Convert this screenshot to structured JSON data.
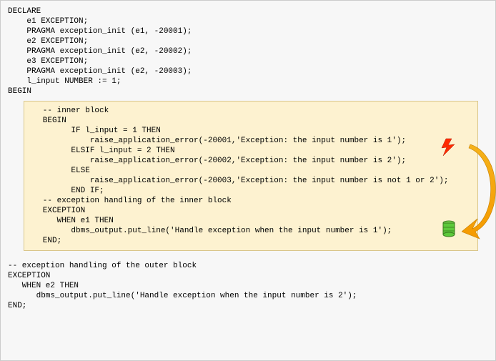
{
  "outer": {
    "l1": "DECLARE",
    "l2": "    e1 EXCEPTION;",
    "l3": "    PRAGMA exception_init (e1, -20001);",
    "l4": "    e2 EXCEPTION;",
    "l5": "    PRAGMA exception_init (e2, -20002);",
    "l6": "    e3 EXCEPTION;",
    "l7": "    PRAGMA exception_init (e2, -20003);",
    "l8": "    l_input NUMBER := 1;",
    "l9": "BEGIN"
  },
  "inner": {
    "l1": "   -- inner block",
    "l2": "   BEGIN",
    "l3": "         IF l_input = 1 THEN",
    "l4": "             raise_application_error(-20001,'Exception: the input number is 1');",
    "l5": "         ELSIF l_input = 2 THEN",
    "l6": "             raise_application_error(-20002,'Exception: the input number is 2');",
    "l7": "         ELSE",
    "l8": "             raise_application_error(-20003,'Exception: the input number is not 1 or 2');",
    "l9": "         END IF;",
    "l10": "   -- exception handling of the inner block",
    "l11": "   EXCEPTION",
    "l12": "      WHEN e1 THEN",
    "l13": "         dbms_output.put_line('Handle exception when the input number is 1');",
    "l14": "   END;"
  },
  "outer2": {
    "l1": "-- exception handling of the outer block",
    "l2": "EXCEPTION",
    "l3": "   WHEN e2 THEN",
    "l4": "      dbms_output.put_line('Handle exception when the input number is 2');",
    "l5": "END;"
  }
}
